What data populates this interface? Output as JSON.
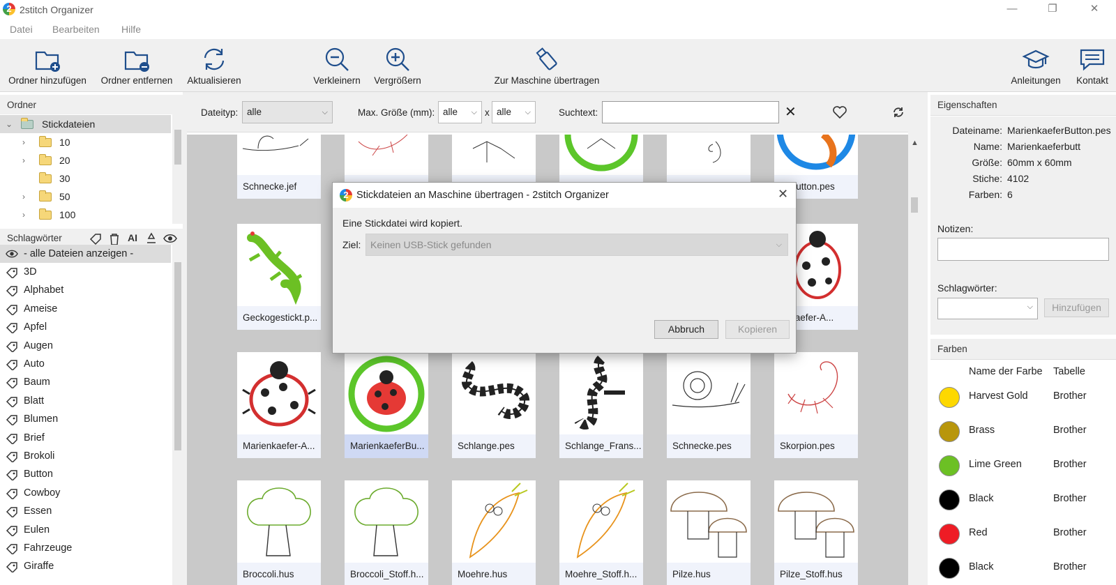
{
  "window": {
    "title": "2stitch Organizer",
    "minimize": "—",
    "maximize": "❐",
    "close": "✕"
  },
  "menu": [
    "Datei",
    "Bearbeiten",
    "Hilfe"
  ],
  "toolbar": {
    "add_folder": "Ordner hinzufügen",
    "remove_folder": "Ordner entfernen",
    "refresh": "Aktualisieren",
    "zoom_out": "Verkleinern",
    "zoom_in": "Vergrößern",
    "transfer": "Zur Maschine übertragen",
    "tutorials": "Anleitungen",
    "contact": "Kontakt"
  },
  "folders_panel": {
    "title": "Ordner",
    "root": "Stickdateien",
    "items": [
      "10",
      "20",
      "30",
      "50",
      "100"
    ]
  },
  "tags_panel": {
    "title": "Schlagwörter",
    "show_all": "- alle Dateien anzeigen -",
    "items": [
      "3D",
      "Alphabet",
      "Ameise",
      "Apfel",
      "Augen",
      "Auto",
      "Baum",
      "Blatt",
      "Blumen",
      "Brief",
      "Brokoli",
      "Button",
      "Cowboy",
      "Essen",
      "Eulen",
      "Fahrzeuge",
      "Giraffe"
    ]
  },
  "filter": {
    "type_label": "Dateityp:",
    "type_value": "alle",
    "size_label": "Max. Größe (mm):",
    "size_w": "alle",
    "size_x": "x",
    "size_h": "alle",
    "search_label": "Suchtext:",
    "clear": "✕"
  },
  "files": {
    "row1": [
      "Schnecke.jef",
      "",
      "",
      "",
      "",
      "koButton.pes"
    ],
    "row2": [
      "Geckogestickt.p...",
      "enkaefer-A..."
    ],
    "row3": [
      "Marienkaefer-A...",
      "MarienkaeferBu...",
      "Schlange.pes",
      "Schlange_Frans...",
      "Schnecke.pes",
      "Skorpion.pes"
    ],
    "row4": [
      "Broccoli.hus",
      "Broccoli_Stoff.h...",
      "Moehre.hus",
      "Moehre_Stoff.h...",
      "Pilze.hus",
      "Pilze_Stoff.hus"
    ]
  },
  "properties": {
    "title": "Eigenschaften",
    "rows": [
      {
        "k": "Dateiname:",
        "v": "MarienkaeferButton.pes"
      },
      {
        "k": "Name:",
        "v": "Marienkaeferbutt"
      },
      {
        "k": "Größe:",
        "v": "60mm x 60mm"
      },
      {
        "k": "Stiche:",
        "v": "4102"
      },
      {
        "k": "Farben:",
        "v": "6"
      }
    ],
    "notes_label": "Notizen:",
    "tags_label": "Schlagwörter:",
    "add_button": "Hinzufügen"
  },
  "colors": {
    "title": "Farben",
    "col_name": "Name der Farbe",
    "col_table": "Tabelle",
    "rows": [
      {
        "name": "Harvest Gold",
        "table": "Brother",
        "hex": "#fdd800"
      },
      {
        "name": "Brass",
        "table": "Brother",
        "hex": "#b8960c"
      },
      {
        "name": "Lime Green",
        "table": "Brother",
        "hex": "#6cc024"
      },
      {
        "name": "Black",
        "table": "Brother",
        "hex": "#000000"
      },
      {
        "name": "Red",
        "table": "Brother",
        "hex": "#ee1c25"
      },
      {
        "name": "Black",
        "table": "Brother",
        "hex": "#000000"
      }
    ]
  },
  "dialog": {
    "title": "Stickdateien an Maschine übertragen - 2stitch Organizer",
    "message": "Eine Stickdatei wird kopiert.",
    "target_label": "Ziel:",
    "target_value": "Keinen USB-Stick gefunden",
    "cancel": "Abbruch",
    "copy": "Kopieren"
  }
}
